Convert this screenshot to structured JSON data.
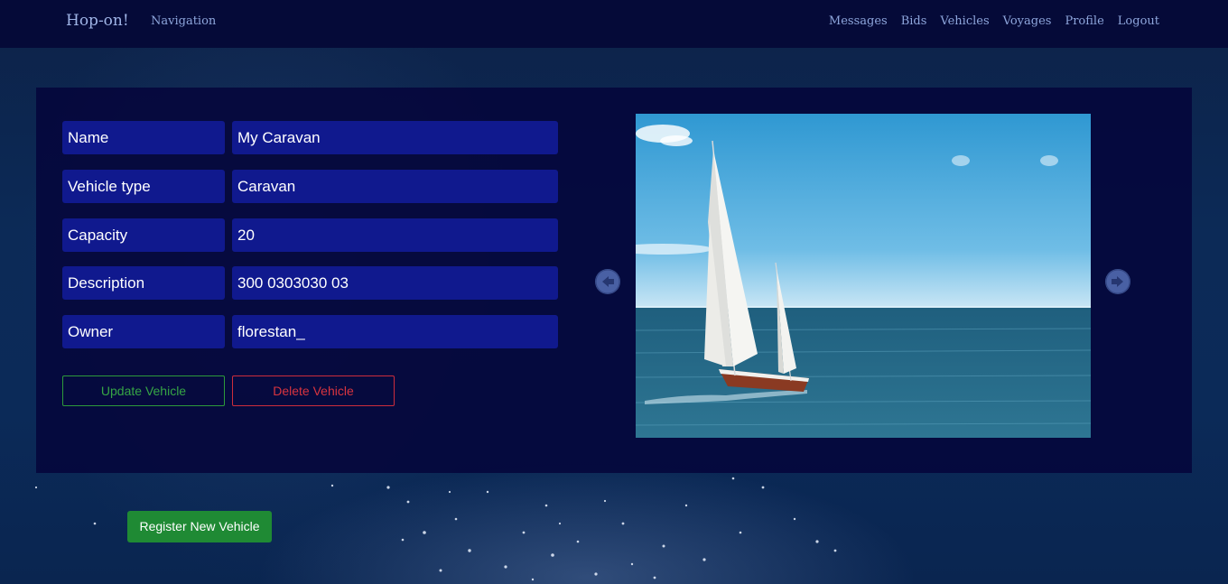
{
  "navbar": {
    "brand": "Hop-on!",
    "navigation_label": "Navigation",
    "links": [
      "Messages",
      "Bids",
      "Vehicles",
      "Voyages",
      "Profile",
      "Logout"
    ]
  },
  "vehicle": {
    "fields": [
      {
        "label": "Name",
        "value": "My Caravan"
      },
      {
        "label": "Vehicle type",
        "value": "Caravan"
      },
      {
        "label": "Capacity",
        "value": "20"
      },
      {
        "label": "Description",
        "value": "300 0303030 03"
      },
      {
        "label": "Owner",
        "value": "florestan_"
      }
    ],
    "update_label": "Update Vehicle",
    "delete_label": "Delete Vehicle"
  },
  "carousel": {
    "prev_icon": "arrow-left-icon",
    "next_icon": "arrow-right-icon",
    "image": "sailboat-photo"
  },
  "register_label": "Register New Vehicle",
  "colors": {
    "navbar": "#050a38",
    "panel": "#05083c",
    "field_bg": "#10198e",
    "success": "#1f8a34",
    "danger": "#d8343f"
  }
}
